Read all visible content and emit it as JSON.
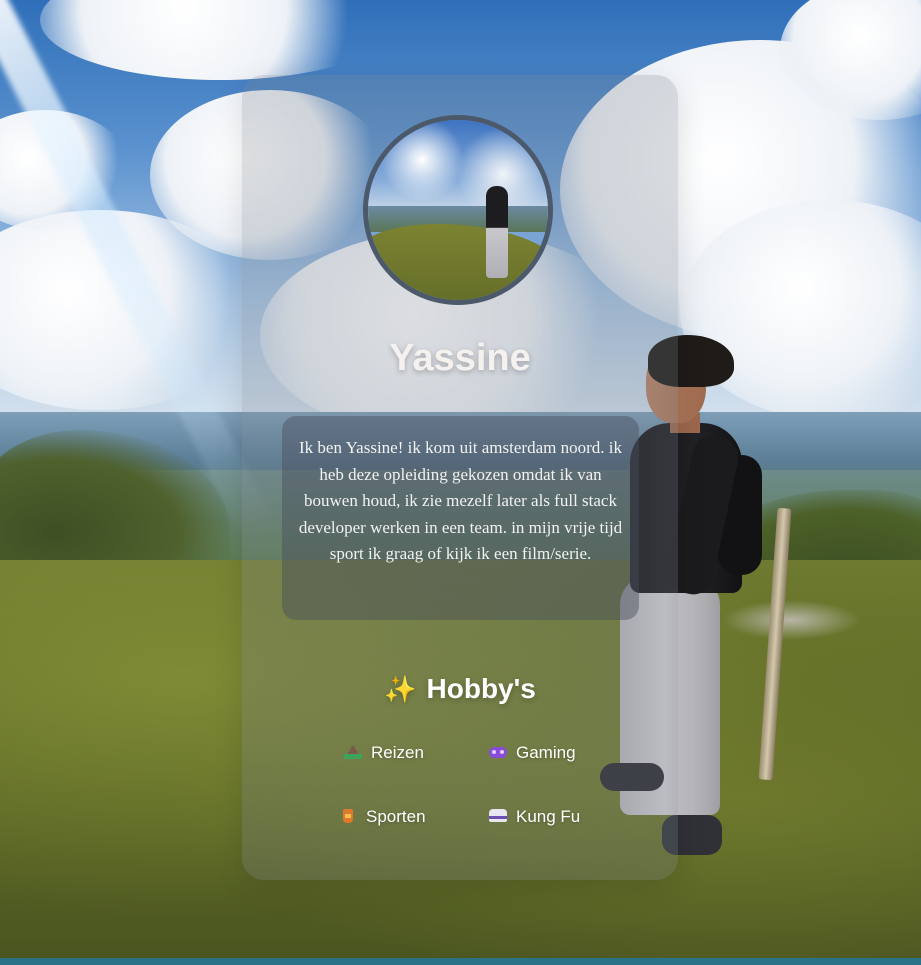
{
  "profile": {
    "name": "Yassine",
    "bio": "Ik ben Yassine! ik kom uit amsterdam noord. ik heb deze opleiding gekozen omdat ik van bouwen houd, ik zie mezelf later als full stack developer werken in een team. in mijn vrije tijd sport ik graag of kijk ik een film/serie."
  },
  "hobbies": {
    "title": "Hobby's",
    "title_icon": "sparkles-icon",
    "items": [
      {
        "label": "Reizen",
        "icon": "mountain-icon"
      },
      {
        "label": "Gaming",
        "icon": "gamepad-icon"
      },
      {
        "label": "Sporten",
        "icon": "trophy-icon"
      },
      {
        "label": "Kung Fu",
        "icon": "martial-arts-uniform-icon"
      }
    ]
  },
  "colors": {
    "card_overlay": "rgba(120,128,138,0.26)",
    "bio_box": "rgba(70,78,90,0.45)",
    "text": "#ffffff",
    "bottom_bar": "#2a7386"
  }
}
